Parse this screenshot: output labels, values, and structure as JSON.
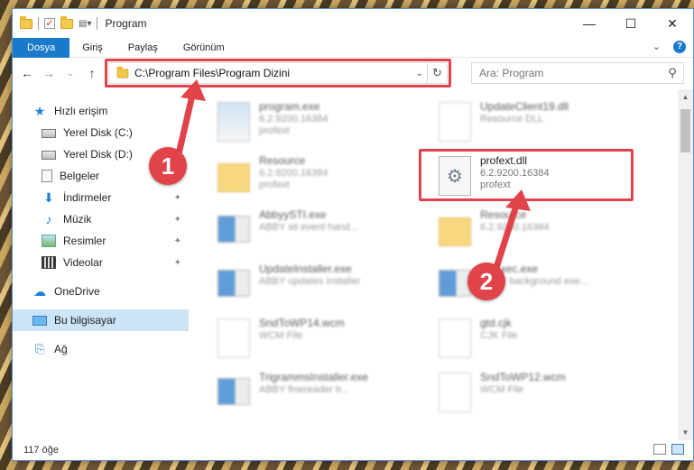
{
  "window": {
    "title": "Program"
  },
  "ribbon": {
    "tabs": [
      "Dosya",
      "Giriş",
      "Paylaş",
      "Görünüm"
    ]
  },
  "address": {
    "path": "C:\\Program Files\\Program Dizini"
  },
  "search": {
    "placeholder": "Ara: Program"
  },
  "sidebar": {
    "items": [
      {
        "label": "Hızlı erişim",
        "icon": "star-icon"
      },
      {
        "label": "Yerel Disk (C:)",
        "icon": "drive-icon"
      },
      {
        "label": "Yerel Disk (D:)",
        "icon": "drive-icon"
      },
      {
        "label": "Belgeler",
        "icon": "documents-icon"
      },
      {
        "label": "İndirmeler",
        "icon": "download-icon"
      },
      {
        "label": "Müzik",
        "icon": "music-icon"
      },
      {
        "label": "Resimler",
        "icon": "pictures-icon"
      },
      {
        "label": "Videolar",
        "icon": "videos-icon"
      },
      {
        "label": "OneDrive",
        "icon": "cloud-icon"
      },
      {
        "label": "Bu bilgisayar",
        "icon": "computer-icon"
      },
      {
        "label": "Ağ",
        "icon": "network-icon"
      }
    ]
  },
  "files": [
    {
      "name": "program.exe",
      "line1": "6.2.9200.16384",
      "line2": "profext"
    },
    {
      "name": "UpdateClient19.dll",
      "line1": "Resource DLL",
      "line2": ""
    },
    {
      "name": "Resource",
      "line1": "6.2.9200.16384",
      "line2": "profext"
    },
    {
      "name": "profext.dll",
      "line1": "6.2.9200.16384",
      "line2": "profext"
    },
    {
      "name": "AbbyySTI.exe",
      "line1": "ABBY sti event hand...",
      "line2": ""
    },
    {
      "name": "Resource",
      "line1": "6.2.9200.16384",
      "line2": ""
    },
    {
      "name": "UpdateInstaller.exe",
      "line1": "ABBY updates installer",
      "line2": ""
    },
    {
      "name": "ShExec.exe",
      "line1": "ABBY background exe...",
      "line2": ""
    },
    {
      "name": "SndToWP14.wcm",
      "line1": "WCM File",
      "line2": ""
    },
    {
      "name": "gtd.cjk",
      "line1": "CJK File",
      "line2": ""
    },
    {
      "name": "TrigrammsInstaller.exe",
      "line1": "ABBY finereader tr...",
      "line2": ""
    },
    {
      "name": "SndToWP12.wcm",
      "line1": "WCM File",
      "line2": ""
    }
  ],
  "status": {
    "count": "117 öğe"
  },
  "callouts": {
    "step1": "1",
    "step2": "2"
  },
  "colors": {
    "accent": "#1979ca",
    "highlight": "#e0444a",
    "selected": "#cce4f7"
  }
}
